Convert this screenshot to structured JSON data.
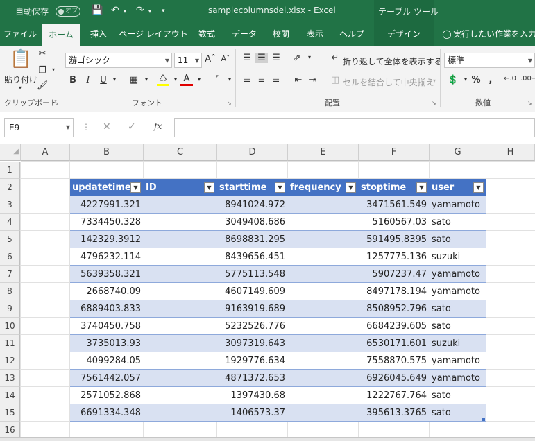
{
  "titlebar": {
    "autosave_label": "自動保存",
    "autosave_state": "オフ",
    "doc_title": "samplecolumnsdel.xlsx  -  Excel",
    "context_tab": "テーブル ツール",
    "accent": "#217346"
  },
  "tabs": [
    "ファイル",
    "ホーム",
    "挿入",
    "ページ レイアウト",
    "数式",
    "データ",
    "校閲",
    "表示",
    "ヘルプ",
    "デザイン",
    "実行したい作業を入力し"
  ],
  "active_tab": "ホーム",
  "ribbon": {
    "clipboard": {
      "paste": "貼り付け",
      "label": "クリップボード"
    },
    "font": {
      "name": "游ゴシック",
      "size": "11",
      "label": "フォント"
    },
    "alignment": {
      "wrap": "折り返して全体を表示する",
      "merge": "セルを結合して中央揃え",
      "label": "配置"
    },
    "number": {
      "format": "標準",
      "label": "数値"
    }
  },
  "formula_bar": {
    "name_box": "E9",
    "fx": "fx",
    "value": ""
  },
  "columns": [
    "A",
    "B",
    "C",
    "D",
    "E",
    "F",
    "G",
    "H"
  ],
  "rows": [
    "1",
    "2",
    "3",
    "4",
    "5",
    "6",
    "7",
    "8",
    "9",
    "10",
    "11",
    "12",
    "13",
    "14",
    "15",
    "16"
  ],
  "table": {
    "headers": [
      "updatetime",
      "ID",
      "starttime",
      "frequency",
      "stoptime",
      "user"
    ],
    "rows": [
      [
        "4227991.321",
        "",
        "8941024.972",
        "",
        "3471561.549",
        "yamamoto"
      ],
      [
        "7334450.328",
        "",
        "3049408.686",
        "",
        "5160567.03",
        "sato"
      ],
      [
        "142329.3912",
        "",
        "8698831.295",
        "",
        "591495.8395",
        "sato"
      ],
      [
        "4796232.114",
        "",
        "8439656.451",
        "",
        "1257775.136",
        "suzuki"
      ],
      [
        "5639358.321",
        "",
        "5775113.548",
        "",
        "5907237.47",
        "yamamoto"
      ],
      [
        "2668740.09",
        "",
        "4607149.609",
        "",
        "8497178.194",
        "yamamoto"
      ],
      [
        "6889403.833",
        "",
        "9163919.689",
        "",
        "8508952.796",
        "sato"
      ],
      [
        "3740450.758",
        "",
        "5232526.776",
        "",
        "6684239.605",
        "sato"
      ],
      [
        "3735013.93",
        "",
        "3097319.643",
        "",
        "6530171.601",
        "suzuki"
      ],
      [
        "4099284.05",
        "",
        "1929776.634",
        "",
        "7558870.575",
        "yamamoto"
      ],
      [
        "7561442.057",
        "",
        "4871372.653",
        "",
        "6926045.649",
        "yamamoto"
      ],
      [
        "2571052.868",
        "",
        "1397430.68",
        "",
        "1222767.764",
        "sato"
      ],
      [
        "6691334.348",
        "",
        "1406573.37",
        "",
        "395613.3765",
        "sato"
      ]
    ],
    "header_color": "#4472c4",
    "band_color": "#d9e1f2"
  }
}
